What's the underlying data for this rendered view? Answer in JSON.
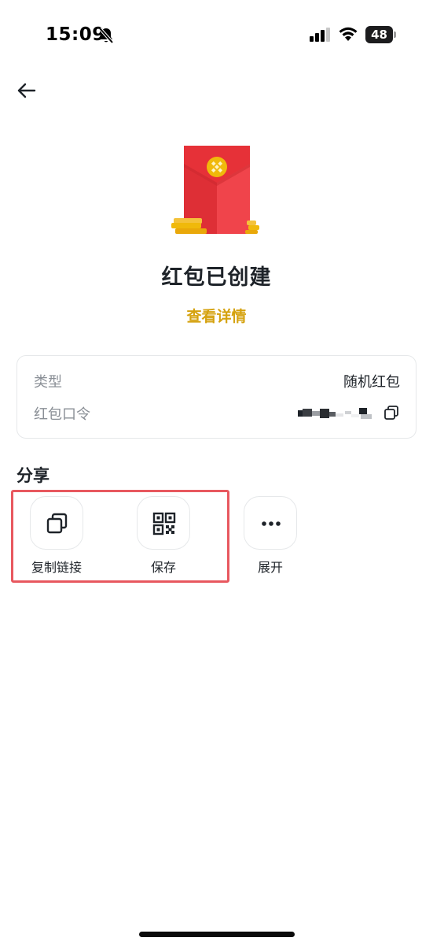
{
  "status_bar": {
    "time": "15:09",
    "battery": "48",
    "icons": [
      "bell-slash-icon",
      "signal-icon",
      "wifi-icon",
      "battery-icon"
    ]
  },
  "header": {
    "back_icon": "arrow-left-icon"
  },
  "main": {
    "title": "红包已创建",
    "details_link": "查看详情"
  },
  "info": {
    "type_label": "类型",
    "type_value": "随机红包",
    "code_label": "红包口令"
  },
  "share": {
    "heading": "分享",
    "items": [
      {
        "label": "复制链接",
        "icon": "copy-icon"
      },
      {
        "label": "保存",
        "icon": "qr-code-icon"
      },
      {
        "label": "展开",
        "icon": "more-icon"
      }
    ]
  },
  "colors": {
    "accent": "#d5a20f",
    "envelope_red": "#ef3a41",
    "highlight": "#e8585f",
    "text": "#1e2329",
    "muted": "#8a8f96"
  }
}
